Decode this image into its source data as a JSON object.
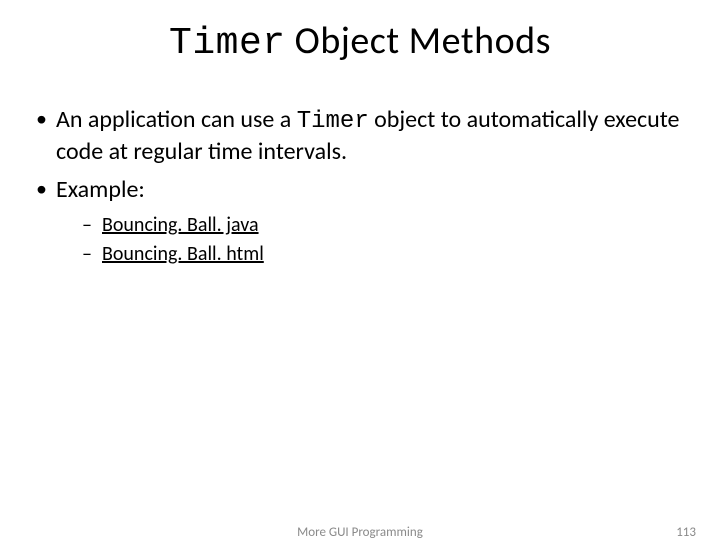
{
  "title": {
    "code": "Timer",
    "rest": " Object Methods"
  },
  "bullet1": {
    "pre": "An application can use a ",
    "code": "Timer",
    "post": " object to automatically execute code at regular time intervals."
  },
  "bullet2": "Example:",
  "links": [
    "Bouncing. Ball. java",
    "Bouncing. Ball. html"
  ],
  "footer": {
    "center": "More GUI Programming",
    "page": "113"
  }
}
